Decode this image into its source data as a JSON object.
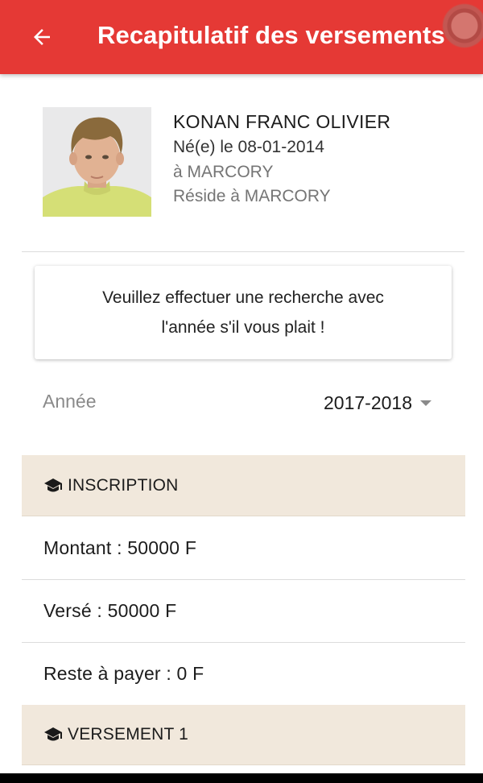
{
  "app_bar": {
    "title": "Recapitulatif des versements",
    "back_icon": "arrow-back-icon",
    "background": "#e53935"
  },
  "student": {
    "photo": "student-photo",
    "name": "KONAN FRANC OLIVIER",
    "birth": "Né(e) le 08-01-2014",
    "birthplace": "à MARCORY",
    "residence": "Réside à MARCORY"
  },
  "notice": {
    "line1": "Veuillez effectuer une recherche avec",
    "line2": "l'année s'il vous plait !"
  },
  "year_filter": {
    "label": "Année",
    "selected": "2017-2018",
    "icon": "dropdown-caret-icon"
  },
  "sections": {
    "inscription": {
      "title": "INSCRIPTION",
      "icon": "graduation-cap-icon",
      "montant": "Montant : 50000 F",
      "verse": "Versé : 50000 F",
      "reste": "Reste à payer : 0 F"
    },
    "versement1": {
      "title": "VERSEMENT 1",
      "icon": "graduation-cap-icon"
    }
  },
  "colors": {
    "accent": "#e53935",
    "section_header_bg": "#f1e8dc"
  }
}
